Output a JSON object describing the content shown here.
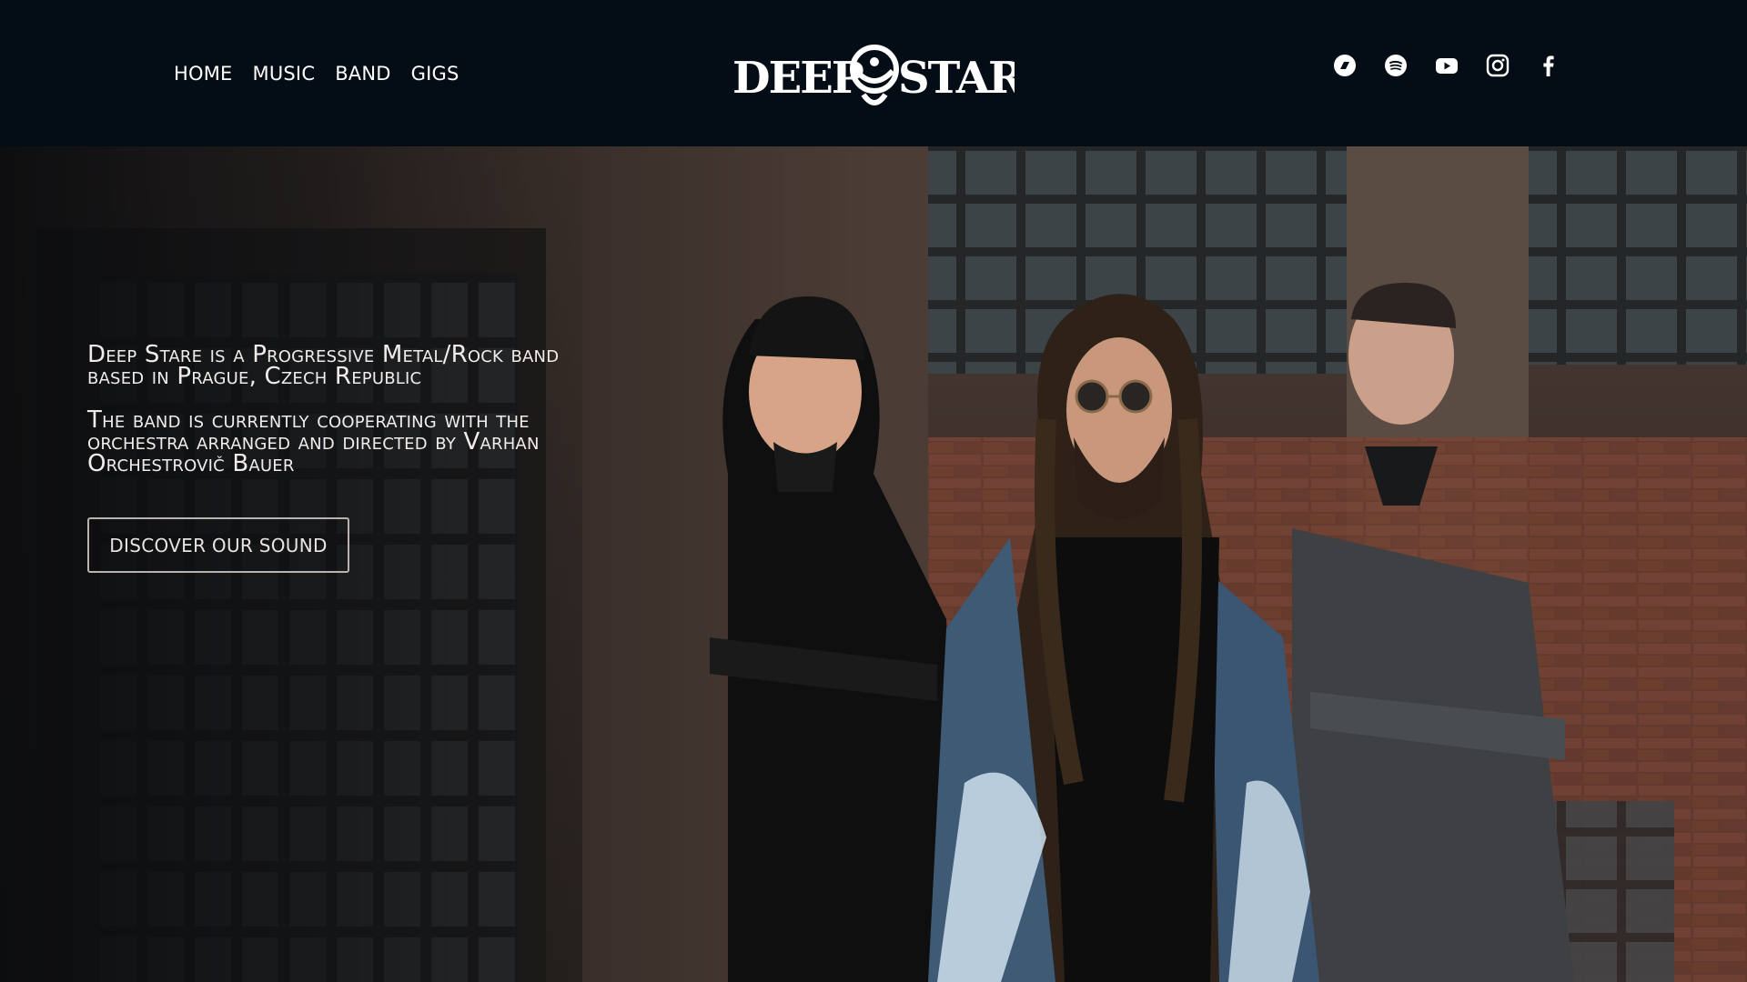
{
  "nav": {
    "items": [
      {
        "label": "HOME"
      },
      {
        "label": "MUSIC"
      },
      {
        "label": "BAND"
      },
      {
        "label": "GIGS"
      }
    ]
  },
  "logo": {
    "text": "DEEP STARE"
  },
  "socials": [
    {
      "icon": "bandcamp-icon"
    },
    {
      "icon": "spotify-icon"
    },
    {
      "icon": "youtube-icon"
    },
    {
      "icon": "instagram-icon"
    },
    {
      "icon": "facebook-icon"
    }
  ],
  "hero": {
    "paragraph_1": "Deep Stare is a Progressive Metal/Rock band based in Prague, Czech Republic",
    "paragraph_2": "The band is currently cooperating with the orchestra arranged and directed by Varhan Orchestrovič Bauer",
    "cta_label": "DISCOVER OUR SOUND"
  },
  "colors": {
    "header_bg": "#040d15",
    "text": "#ffffff"
  }
}
